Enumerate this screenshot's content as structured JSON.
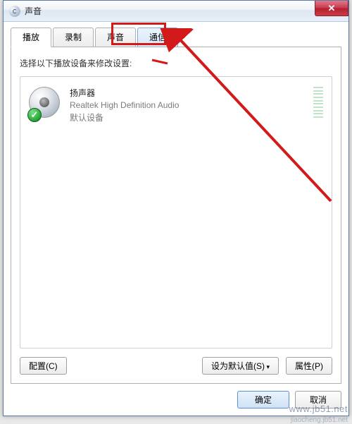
{
  "window": {
    "title": "声音",
    "close_glyph": "✕"
  },
  "tabs": {
    "items": [
      {
        "label": "播放"
      },
      {
        "label": "录制"
      },
      {
        "label": "声音"
      },
      {
        "label": "通信"
      }
    ]
  },
  "panel": {
    "instruction": "选择以下播放设备来修改设置:"
  },
  "devices": [
    {
      "name": "扬声器",
      "description": "Realtek High Definition Audio",
      "status": "默认设备",
      "check_glyph": "✓"
    }
  ],
  "buttons": {
    "configure": "配置(C)",
    "set_default": "设为默认值(S)",
    "properties": "属性(P)",
    "ok": "确定",
    "cancel": "取消"
  },
  "watermark": {
    "main": "www.jb51.net",
    "sub": "jiaocheng.jb51.net"
  }
}
